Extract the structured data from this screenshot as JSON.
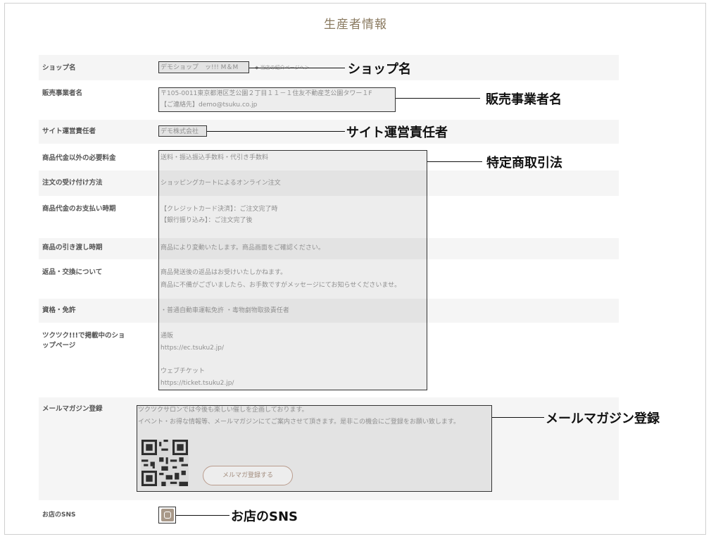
{
  "title": "生産者情報",
  "rows": [
    {
      "label": "ショップ名",
      "lines": [
        "デモショップ　ッ!!! M＆M"
      ],
      "link": "◆ 当店の紹介ページへ＞"
    },
    {
      "label": "販売事業者名",
      "lines": [
        "〒105-0011東京都港区芝公園２丁目１１－１住友不動産芝公園タワー１F",
        "【ご連絡先】demo@tsuku.co.jp"
      ]
    },
    {
      "label": "サイト運営責任者",
      "lines": [
        "デモ株式会社"
      ]
    },
    {
      "label": "商品代金以外の必要料金",
      "lines": [
        "送料・振込振込手数料・代引き手数料"
      ]
    },
    {
      "label": "注文の受け付け方法",
      "lines": [
        "ショッピングカートによるオンライン注文"
      ]
    },
    {
      "label": "商品代金のお支払い時期",
      "lines": [
        "【クレジットカード決済】：ご注文完了時",
        "【銀行振り込み】：ご注文完了後"
      ]
    },
    {
      "label": "商品の引き渡し時期",
      "lines": [
        "商品により変動いたします。商品画面をご確認ください。"
      ]
    },
    {
      "label": "返品・交換について",
      "lines": [
        "商品発送後の返品はお受けいたしかねます。",
        "商品に不備がございましたら、お手数ですがメッセージにてお知らせくださいませ。"
      ]
    },
    {
      "label": "資格・免許",
      "lines": [
        "・普通自動車運転免許 ・毒物劇物取扱責任者"
      ]
    },
    {
      "label": "ツクツク!!!で掲載中のショップページ",
      "label_lines": [
        "ツクツク!!!で掲載中のショ",
        "ップページ"
      ],
      "lines": [
        "通販",
        "https://ec.tsuku2.jp/",
        "",
        "ウェブチケット",
        "https://ticket.tsuku2.jp/"
      ]
    },
    {
      "label": "メールマガジン登録",
      "lines": [
        "ツクツクサロンでは今後も楽しい催しを企画しております。",
        "イベント・お得な情報等、メールマガジンにてご案内させて頂きます。是非この機会にご登録をお願い致します。"
      ],
      "button": "メルマガ登録する"
    },
    {
      "label": "お店のSNS",
      "lines": []
    }
  ],
  "annotations": {
    "shop_name": "ショップ名",
    "business_name": "販売事業者名",
    "site_manager": "サイト運営責任者",
    "specified_commerce": "特定商取引法",
    "mail_magazine": "メールマガジン登録",
    "sns": "お店のSNS"
  },
  "icons": {
    "sns": "instagram-icon",
    "qr": "qr-code-icon"
  }
}
